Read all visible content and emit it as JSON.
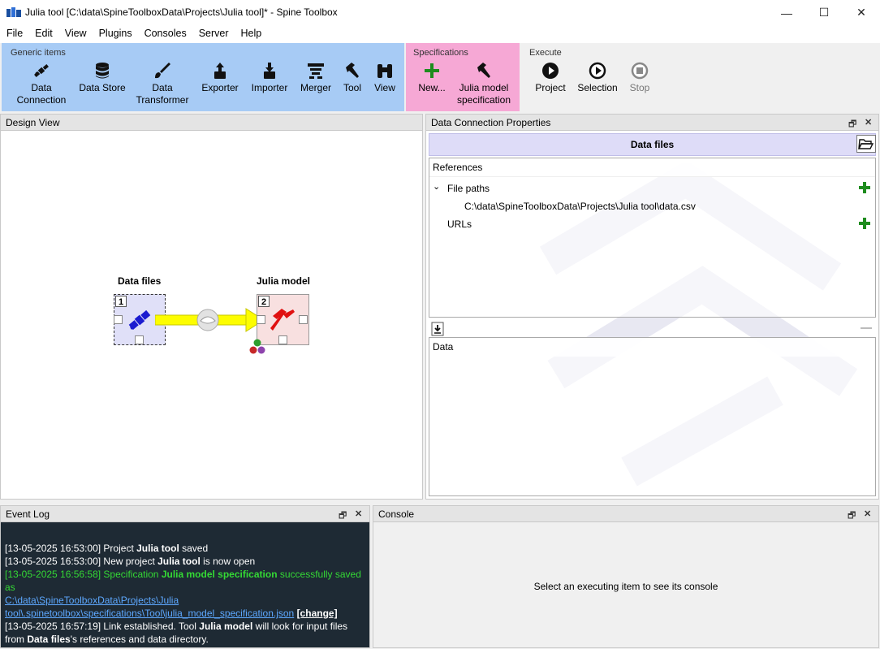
{
  "window": {
    "title": "Julia tool [C:\\data\\SpineToolboxData\\Projects\\Julia tool]* - Spine Toolbox",
    "minimize": "—",
    "maximize": "☐",
    "close": "✕"
  },
  "menu": [
    "File",
    "Edit",
    "View",
    "Plugins",
    "Consoles",
    "Server",
    "Help"
  ],
  "toolbar": {
    "generic_title": "Generic items",
    "generic_items": [
      {
        "label1": "Data",
        "label2": "Connection"
      },
      {
        "label1": "Data Store",
        "label2": ""
      },
      {
        "label1": "Data",
        "label2": "Transformer"
      },
      {
        "label1": "Exporter",
        "label2": ""
      },
      {
        "label1": "Importer",
        "label2": ""
      },
      {
        "label1": "Merger",
        "label2": ""
      },
      {
        "label1": "Tool",
        "label2": ""
      },
      {
        "label1": "View",
        "label2": ""
      }
    ],
    "spec_title": "Specifications",
    "spec_new": "New...",
    "spec_julia1": "Julia model",
    "spec_julia2": "specification",
    "execute_title": "Execute",
    "exec_project": "Project",
    "exec_selection": "Selection",
    "exec_stop": "Stop",
    "colors": {
      "generic_bg": "#9fc5f6",
      "spec_bg": "#f7a9d6",
      "accent_green": "#1e8c1e"
    }
  },
  "design_view": {
    "title": "Design View",
    "node1": {
      "label": "Data files",
      "index": "1"
    },
    "node2": {
      "label": "Julia model",
      "index": "2"
    }
  },
  "properties": {
    "title": "Data Connection Properties",
    "section_title": "Data files",
    "references_header": "References",
    "file_paths_label": "File paths",
    "file_path": "C:\\data\\SpineToolboxData\\Projects\\Julia tool\\data.csv",
    "urls_label": "URLs",
    "data_header": "Data"
  },
  "event_log": {
    "title": "Event Log",
    "lines": {
      "l1_ts": "[13-05-2025 16:53:00] Project ",
      "l1_bold": "Julia tool",
      "l1_rest": " saved",
      "l2_ts": "[13-05-2025 16:53:00] New project ",
      "l2_bold": "Julia tool",
      "l2_rest": " is now open",
      "l3_ts": "[13-05-2025 16:56:58] Specification ",
      "l3_bold": "Julia model specification",
      "l3_rest": " successfully saved as",
      "l3_link1": "C:\\data\\SpineToolboxData\\Projects\\Julia",
      "l3_link2": "tool\\.spinetoolbox\\specifications\\Tool\\julia_model_specification.json",
      "l3_change": "[change]",
      "l4_ts": "[13-05-2025 16:57:19] Link established. Tool ",
      "l4_bold": "Julia model",
      "l4_rest": " will look for input files",
      "l5_from": "from ",
      "l5_bold": "Data files",
      "l5_rest": "'s references and data directory."
    }
  },
  "console": {
    "title": "Console",
    "message": "Select an executing item to see its console"
  }
}
